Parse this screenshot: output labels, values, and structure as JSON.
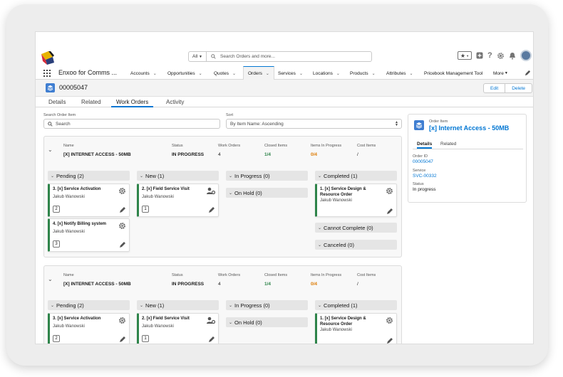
{
  "app": {
    "name": "Enxoo for Comms ..."
  },
  "search": {
    "scope": "All",
    "placeholder": "Search Orders and more..."
  },
  "nav": {
    "items": [
      {
        "label": "Accounts"
      },
      {
        "label": "Opportunities"
      },
      {
        "label": "Quotes"
      },
      {
        "label": "Orders",
        "active": true
      },
      {
        "label": "Services"
      },
      {
        "label": "Locations"
      },
      {
        "label": "Products"
      },
      {
        "label": "Attributes"
      },
      {
        "label": "Pricebook Management Tool"
      },
      {
        "label": "More"
      }
    ]
  },
  "record": {
    "number": "00005047",
    "edit_label": "Edit",
    "delete_label": "Delete"
  },
  "tabs": [
    "Details",
    "Related",
    "Work Orders",
    "Activity"
  ],
  "filters": {
    "search_label": "Search Order Item",
    "search_placeholder": "Search",
    "sort_label": "Sort",
    "sort_value": "By Item Name: Ascending"
  },
  "group_headers": {
    "name": "Name",
    "status": "Status",
    "work_orders": "Work Orders",
    "closed_items": "Closed Items",
    "items_in_progress": "Items In Progress",
    "cost_items": "Cost Items"
  },
  "groups": [
    {
      "name": "[X] INTERNET ACCESS - 50MB",
      "status": "IN PROGRESS",
      "work_orders": "4",
      "closed_items": "1/4",
      "items_in_progress": "0/4",
      "cost_items": "/",
      "columns": {
        "pending": "Pending (2)",
        "new": "New (1)",
        "in_progress": "In Progress (0)",
        "on_hold": "On Hold (0)",
        "completed": "Completed (1)",
        "cannot_complete": "Cannot Complete (0)",
        "canceled": "Canceled (0)"
      },
      "cards": {
        "activation": {
          "title": "3. [x] Service Activation",
          "owner": "Jakub Wanowski",
          "badge": "2"
        },
        "billing": {
          "title": "4. [x] Notify Billing system",
          "owner": "Jakub Wanowski",
          "badge": "3"
        },
        "visit": {
          "title": "2. [x] Field Service Visit",
          "owner": "Jakub Wanowski",
          "badge": "1"
        },
        "design": {
          "title": "1. [x] Service Design & Resource Order",
          "owner": "Jakub Wanowski"
        }
      }
    },
    {
      "name": "[X] INTERNET ACCESS - 50MB",
      "status": "IN PROGRESS",
      "work_orders": "4",
      "closed_items": "1/4",
      "items_in_progress": "0/4",
      "cost_items": "/",
      "columns": {
        "pending": "Pending (2)",
        "new": "New (1)",
        "in_progress": "In Progress (0)",
        "on_hold": "On Hold (0)",
        "completed": "Completed (1)"
      },
      "cards": {
        "activation": {
          "title": "3. [x] Service Activation",
          "owner": "Jakub Wanowski",
          "badge": "2"
        },
        "visit": {
          "title": "2. [x] Field Service Visit",
          "owner": "Jakub Wanowski",
          "badge": "1"
        },
        "design": {
          "title": "1. [x] Service Design & Resource Order",
          "owner": "Jakub Wanowski"
        }
      }
    }
  ],
  "side_panel": {
    "subtitle": "Order Item",
    "title": "[x] Internet Access - 50MB",
    "tabs": [
      "Details",
      "Related"
    ],
    "fields": {
      "order_id_label": "Order ID",
      "order_id": "00005047",
      "service_label": "Service",
      "service": "SVC-00332",
      "status_label": "Status",
      "status": "In progress"
    }
  },
  "colors": {
    "accent": "#0176d3",
    "success": "#2e844a",
    "warning": "#dd7a01",
    "icon_bg": "#3f7ed1"
  }
}
